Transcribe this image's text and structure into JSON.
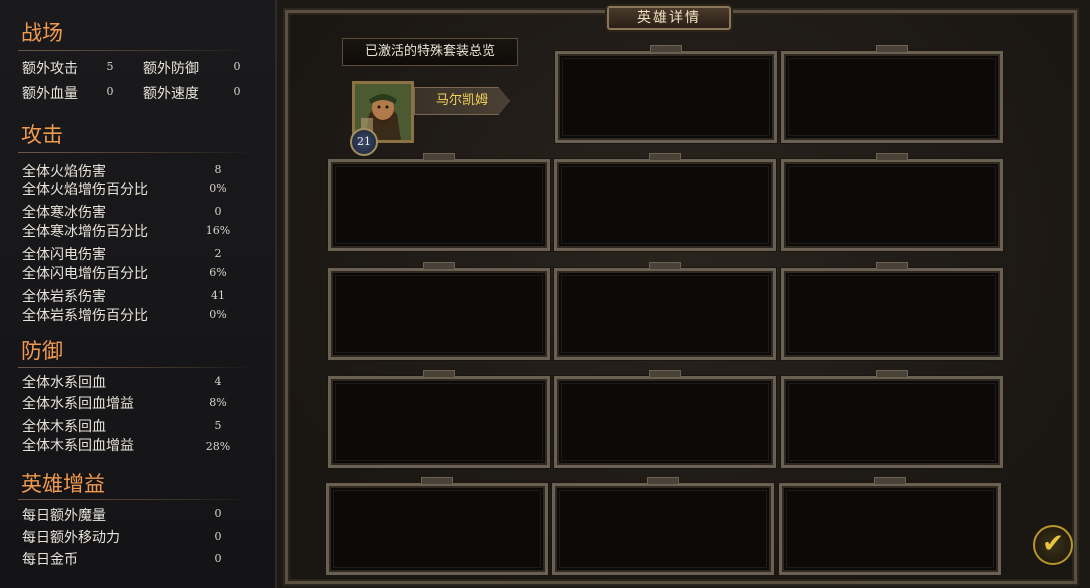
{
  "left_panel": {
    "battlefield": {
      "title": "战场",
      "stats": [
        {
          "label": "额外攻击",
          "value": "5"
        },
        {
          "label": "额外防御",
          "value": "0"
        },
        {
          "label": "额外血量",
          "value": "0"
        },
        {
          "label": "额外速度",
          "value": "0"
        }
      ]
    },
    "attack": {
      "title": "攻击",
      "stats": [
        {
          "label": "全体火焰伤害",
          "value": "8"
        },
        {
          "label": "全体火焰增伤百分比",
          "value": "0%"
        },
        {
          "label": "全体寒冰伤害",
          "value": "0"
        },
        {
          "label": "全体寒冰增伤百分比",
          "value": "16%"
        },
        {
          "label": "全体闪电伤害",
          "value": "2"
        },
        {
          "label": "全体闪电增伤百分比",
          "value": "6%"
        },
        {
          "label": "全体岩系伤害",
          "value": "41"
        },
        {
          "label": "全体岩系增伤百分比",
          "value": "0%"
        }
      ]
    },
    "defense": {
      "title": "防御",
      "stats": [
        {
          "label": "全体水系回血",
          "value": "4"
        },
        {
          "label": "全体水系回血增益",
          "value": "8%"
        },
        {
          "label": "全体木系回血",
          "value": "5"
        },
        {
          "label": "全体木系回血增益",
          "value": "28%"
        }
      ]
    },
    "hero_bonus": {
      "title": "英雄增益",
      "stats": [
        {
          "label": "每日额外魔量",
          "value": "0"
        },
        {
          "label": "每日额外移动力",
          "value": "0"
        },
        {
          "label": "每日金币",
          "value": "0"
        }
      ]
    }
  },
  "main": {
    "title": "英雄详情",
    "overview_label": "已激活的特殊套装总览",
    "hero": {
      "name": "马尔凯姆",
      "level": "21"
    },
    "confirm_icon": "checkmark-icon"
  }
}
